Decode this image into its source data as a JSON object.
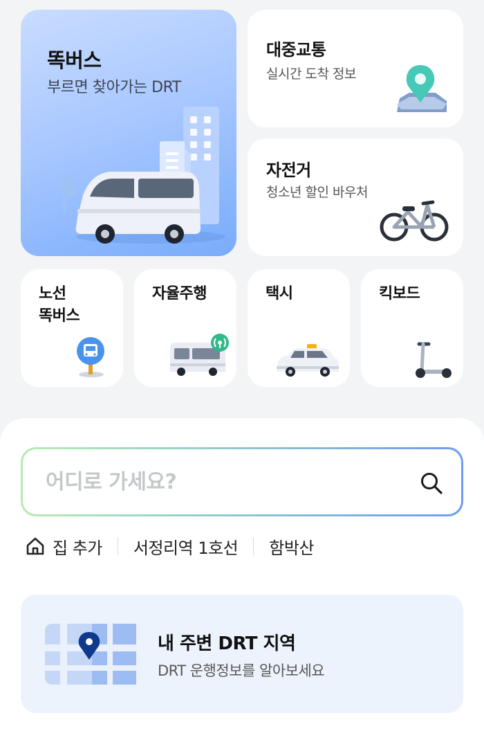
{
  "services": {
    "ttokbus": {
      "title": "똑버스",
      "subtitle": "부르면 찾아가는 DRT"
    },
    "transit": {
      "title": "대중교통",
      "subtitle": "실시간 도착 정보"
    },
    "bike": {
      "title": "자전거",
      "subtitle": "청소년 할인 바우처"
    },
    "route_ttokbus": {
      "title_line1": "노선",
      "title_line2": "똑버스"
    },
    "autonomous": {
      "title": "자율주행"
    },
    "taxi": {
      "title": "택시"
    },
    "kickboard": {
      "title": "킥보드"
    }
  },
  "search": {
    "placeholder": "어디로 가세요?",
    "value": ""
  },
  "quick_destinations": {
    "home": "집 추가",
    "place1": "서정리역 1호선",
    "place2": "함박산"
  },
  "drt_banner": {
    "title": "내 주변 DRT 지역",
    "subtitle": "DRT 운행정보를 알아보세요"
  },
  "colors": {
    "accent_blue": "#79acfb",
    "map_pin": "#0f3a8c",
    "search_gradient_start": "#b7ecb0",
    "search_gradient_end": "#6d9cf2"
  },
  "icons": {
    "ttokbus": "van-icon",
    "transit": "map-pin-icon",
    "bike": "bicycle-icon",
    "route": "bus-stop-icon",
    "autonomous": "autonomous-bus-icon",
    "taxi": "taxi-icon",
    "kickboard": "kickboard-icon",
    "search": "search-icon",
    "home": "home-icon",
    "drt_map": "map-icon"
  }
}
